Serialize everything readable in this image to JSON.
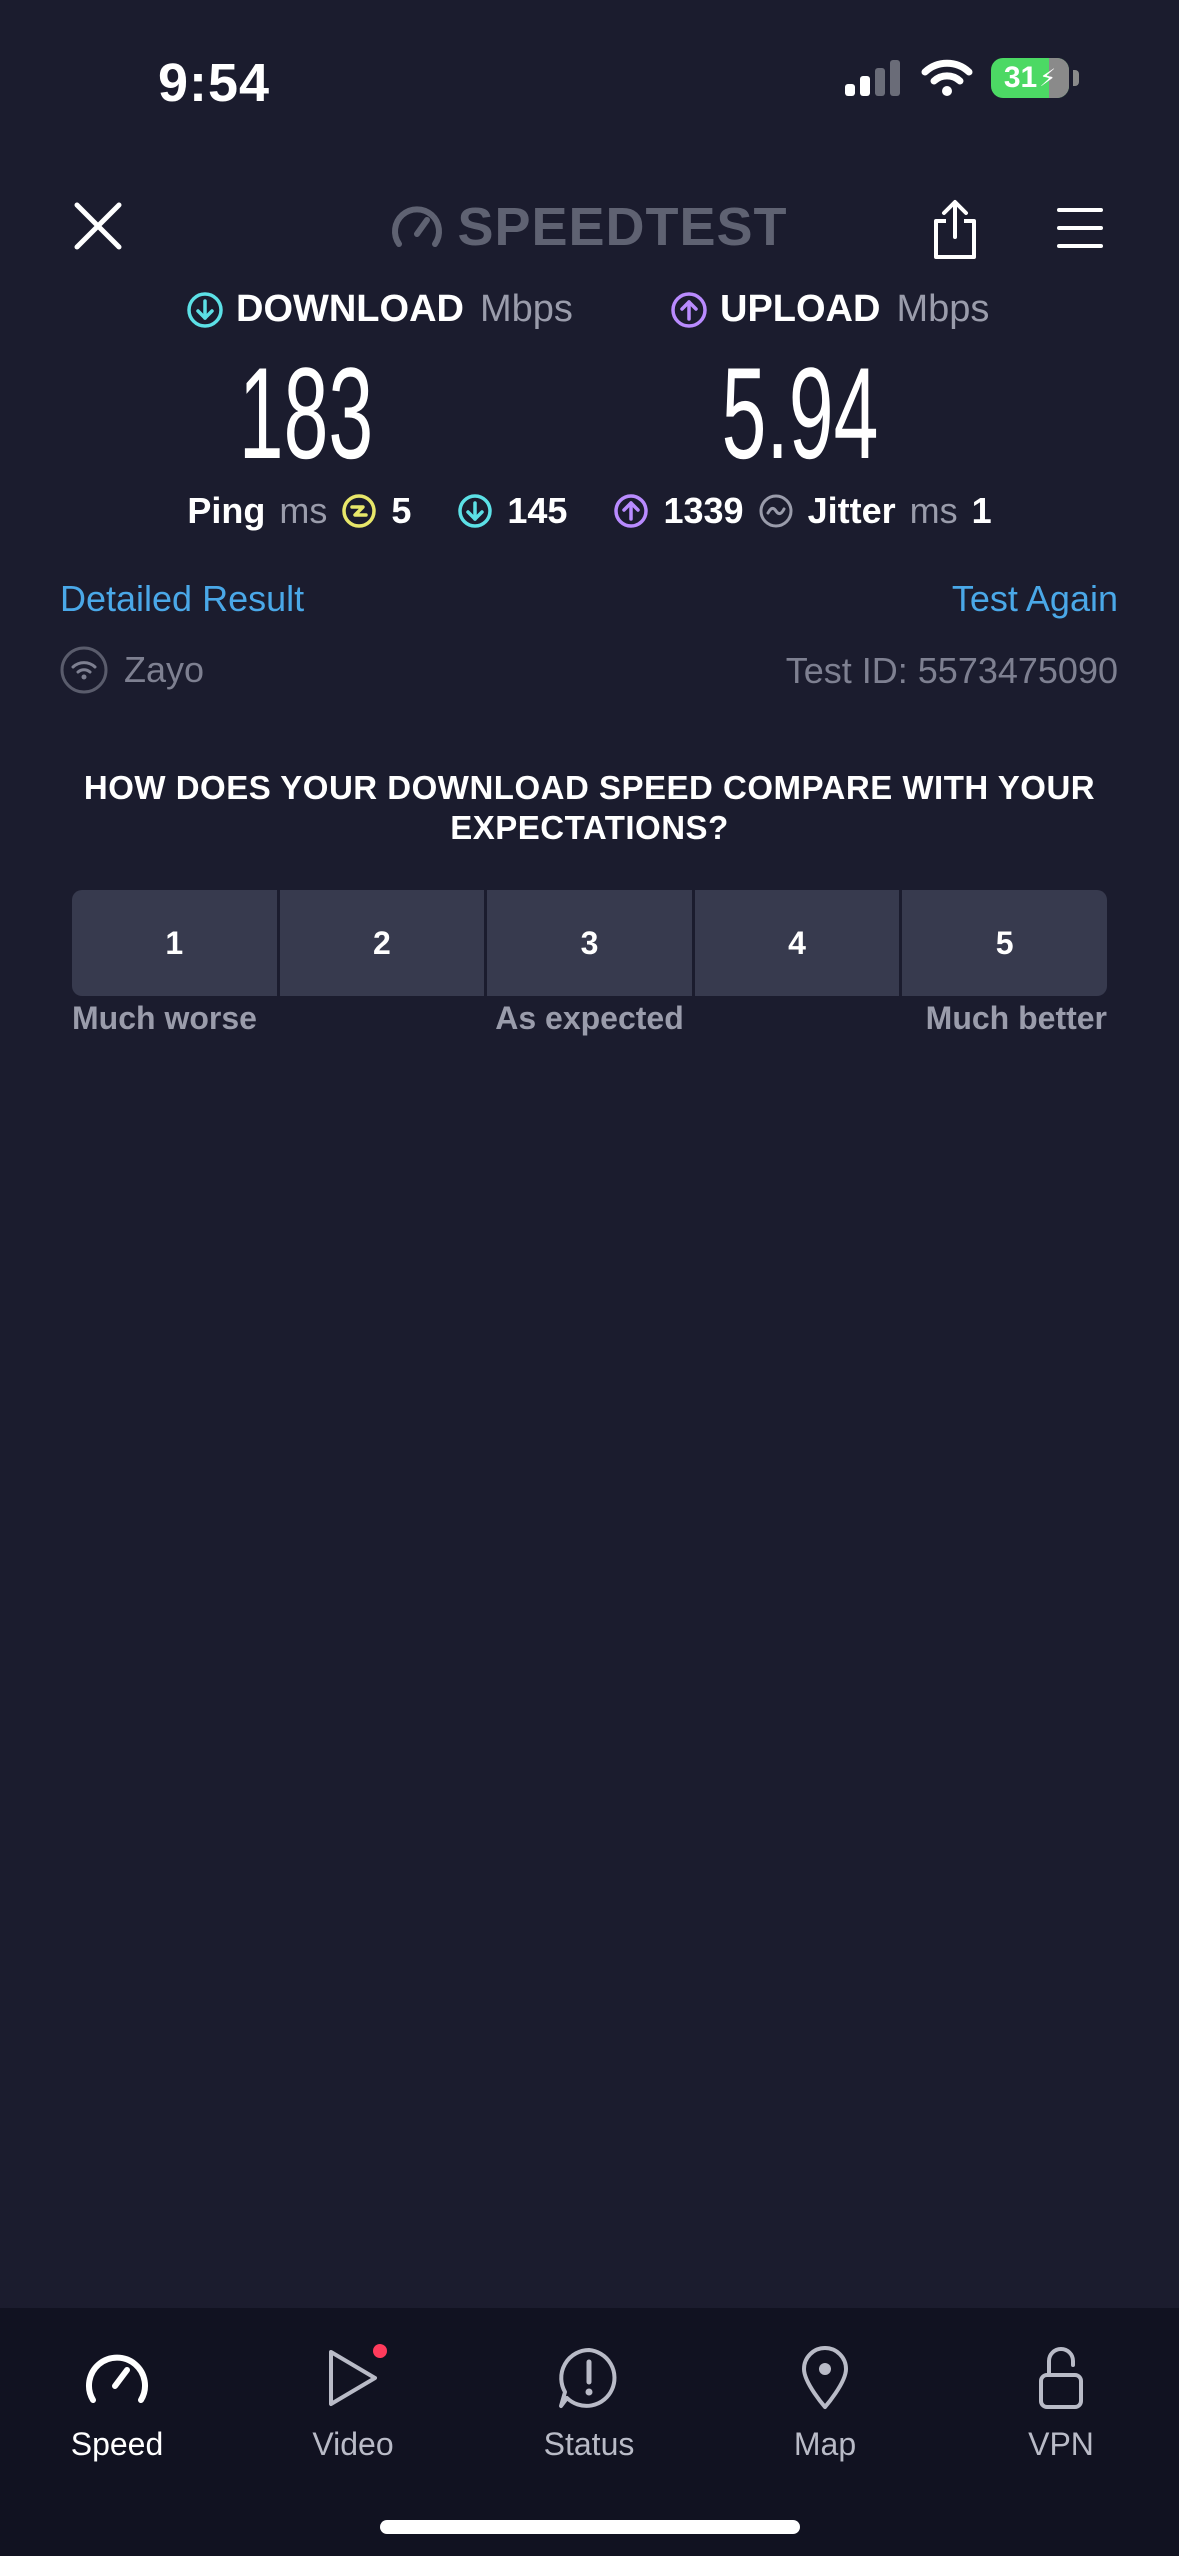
{
  "status_bar": {
    "time": "9:54",
    "battery": "31"
  },
  "header": {
    "brand": "SPEEDTEST"
  },
  "download": {
    "label": "DOWNLOAD",
    "unit": "Mbps",
    "value": "183"
  },
  "upload": {
    "label": "UPLOAD",
    "unit": "Mbps",
    "value": "5.94"
  },
  "ping": {
    "label": "Ping",
    "unit": "ms",
    "idle": "5",
    "down": "145",
    "up": "1339",
    "jitter_label": "Jitter",
    "jitter_unit": "ms",
    "jitter": "1"
  },
  "links": {
    "detailed": "Detailed Result",
    "again": "Test Again"
  },
  "isp": {
    "name": "Zayo",
    "test_id": "Test ID: 5573475090"
  },
  "survey": {
    "question": "HOW DOES YOUR DOWNLOAD SPEED COMPARE WITH YOUR EXPECTATIONS?",
    "options": [
      "1",
      "2",
      "3",
      "4",
      "5"
    ],
    "caption_left": "Much worse",
    "caption_mid": "As expected",
    "caption_right": "Much better"
  },
  "tabs": [
    {
      "label": "Speed",
      "icon": "speedometer-icon"
    },
    {
      "label": "Video",
      "icon": "play-icon"
    },
    {
      "label": "Status",
      "icon": "alert-bubble-icon"
    },
    {
      "label": "Map",
      "icon": "map-pin-icon"
    },
    {
      "label": "VPN",
      "icon": "unlock-icon"
    }
  ],
  "colors": {
    "background": "#1b1c2e",
    "download_accent": "#5ce0e6",
    "upload_accent": "#b98bff",
    "ping_accent": "#e8e76a",
    "link": "#4aa8e8"
  }
}
